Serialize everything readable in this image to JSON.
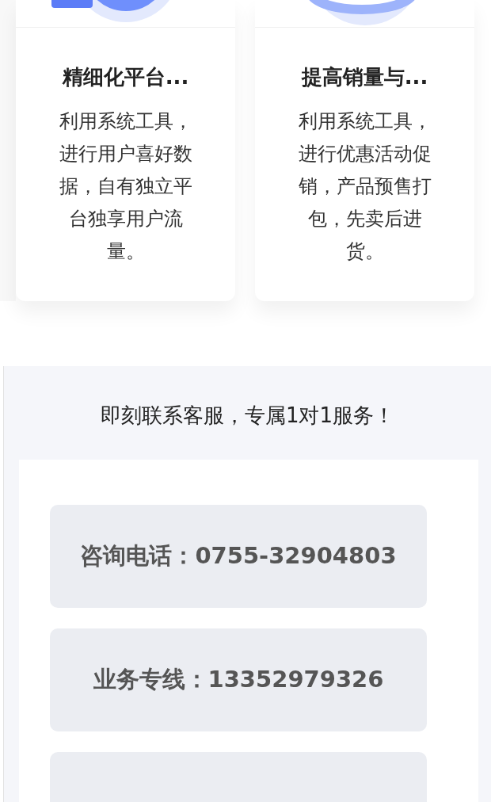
{
  "cards": [
    {
      "kind": "data",
      "title": "精细化平台...",
      "description": "利用系统工具，进行用户喜好数据，自有独立平台独享用户流量。"
    },
    {
      "kind": "sales",
      "title": "提高销量与...",
      "description": "利用系统工具，进行优惠活动促销，产品预售打包，先卖后进货。"
    }
  ],
  "contact": {
    "heading": "即刻联系客服，专属1对1服务！",
    "lines": [
      {
        "kind": "text",
        "text": "咨询电话：0755-32904803"
      },
      {
        "kind": "text",
        "text": "业务专线：13352979326"
      },
      {
        "kind": "cut"
      }
    ]
  }
}
